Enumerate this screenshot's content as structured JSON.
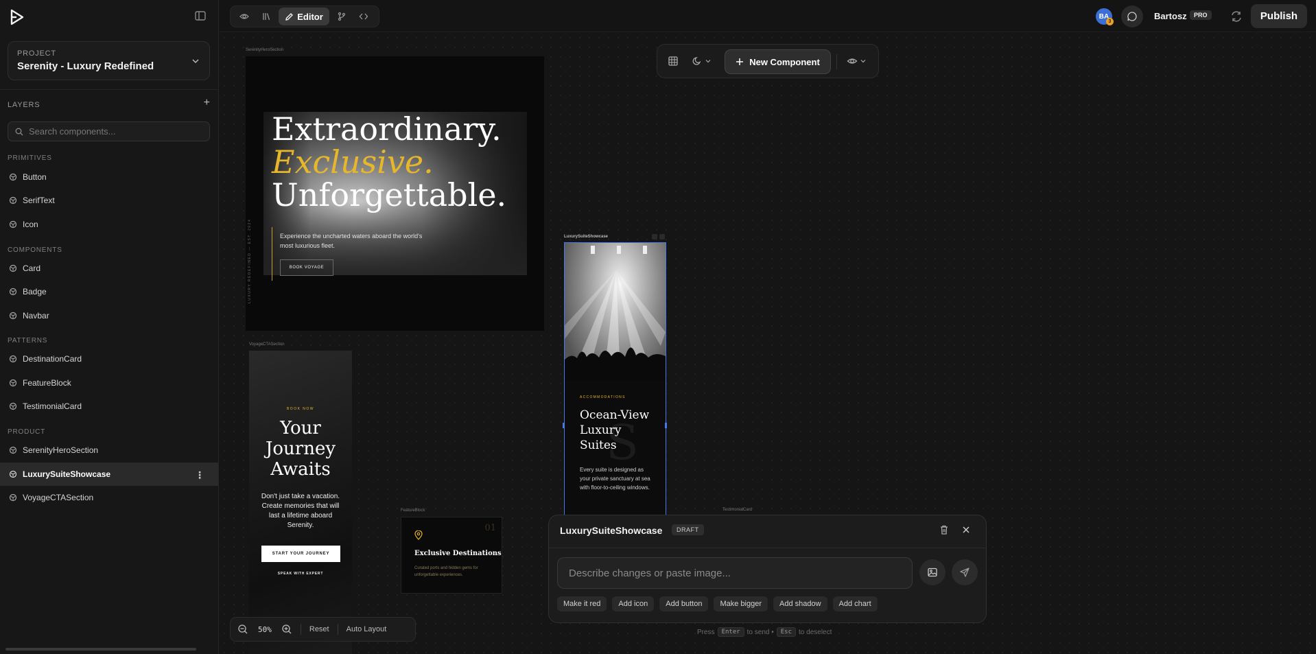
{
  "sidebar": {
    "project_label": "PROJECT",
    "project_name": "Serenity - Luxury Redefined",
    "layers_title": "LAYERS",
    "search_placeholder": "Search components...",
    "sections": {
      "primitives": "PRIMITIVES",
      "components": "COMPONENTS",
      "patterns": "PATTERNS",
      "product": "PRODUCT"
    },
    "primitives": [
      "Button",
      "SerifText",
      "Icon"
    ],
    "components": [
      "Card",
      "Badge",
      "Navbar"
    ],
    "patterns": [
      "DestinationCard",
      "FeatureBlock",
      "TestimonialCard"
    ],
    "product": [
      "SerenityHeroSection",
      "LuxurySuiteShowcase",
      "VoyageCTASection"
    ],
    "active_item": "LuxurySuiteShowcase"
  },
  "topbar": {
    "editor_label": "Editor",
    "avatar_initials": "BA",
    "avatar_count": "3",
    "user_name": "Bartosz",
    "plan_badge": "PRO",
    "publish_label": "Publish"
  },
  "canvas_toolbar": {
    "new_component_label": "New Component"
  },
  "frames": {
    "hero": {
      "label": "SerenityHeroSection",
      "line1": "Extraordinary.",
      "line2": "Exclusive.",
      "line3": "Unforgettable.",
      "body": "Experience the uncharted waters aboard the world's most luxurious fleet.",
      "button": "BOOK VOYAGE",
      "vertical_text": "LUXURY REDEFINED — EST. 2024"
    },
    "voyage": {
      "label": "VoyageCTASection",
      "kicker": "BOOK NOW",
      "line1": "Your",
      "line2": "Journey",
      "line3": "Awaits",
      "body": "Don't just take a vacation. Create memories that will last a lifetime aboard Serenity.",
      "button": "START YOUR JOURNEY",
      "link": "SPEAK WITH EXPERT"
    },
    "feature": {
      "label": "FeatureBlock",
      "number": "01",
      "title": "Exclusive Destinations",
      "body": "Curated ports and hidden gems for unforgettable experiences."
    },
    "testimonial": {
      "label": "TestimonialCard"
    },
    "lux": {
      "label": "LuxurySuiteShowcase",
      "kicker": "ACCOMMODATIONS",
      "line1": "Ocean-View",
      "line2": "Luxury",
      "line3": "Suites",
      "body": "Every suite is designed as your private sanctuary at sea with floor-to-ceiling windows."
    }
  },
  "ai_panel": {
    "title": "LuxurySuiteShowcase",
    "status": "DRAFT",
    "input_placeholder": "Describe changes or paste image...",
    "chips": [
      "Make it red",
      "Add icon",
      "Add button",
      "Make bigger",
      "Add shadow",
      "Add chart"
    ],
    "hint_press": "Press",
    "hint_enter": "Enter",
    "hint_send": "to send •",
    "hint_esc": "Esc",
    "hint_deselect": "to deselect"
  },
  "zoom": {
    "value": "50%",
    "reset_label": "Reset",
    "auto_layout_label": "Auto Layout"
  },
  "colors": {
    "accent_gold": "#e7b72b",
    "selection_blue": "#4a78e8",
    "avatar_blue": "#3b6fd6"
  }
}
